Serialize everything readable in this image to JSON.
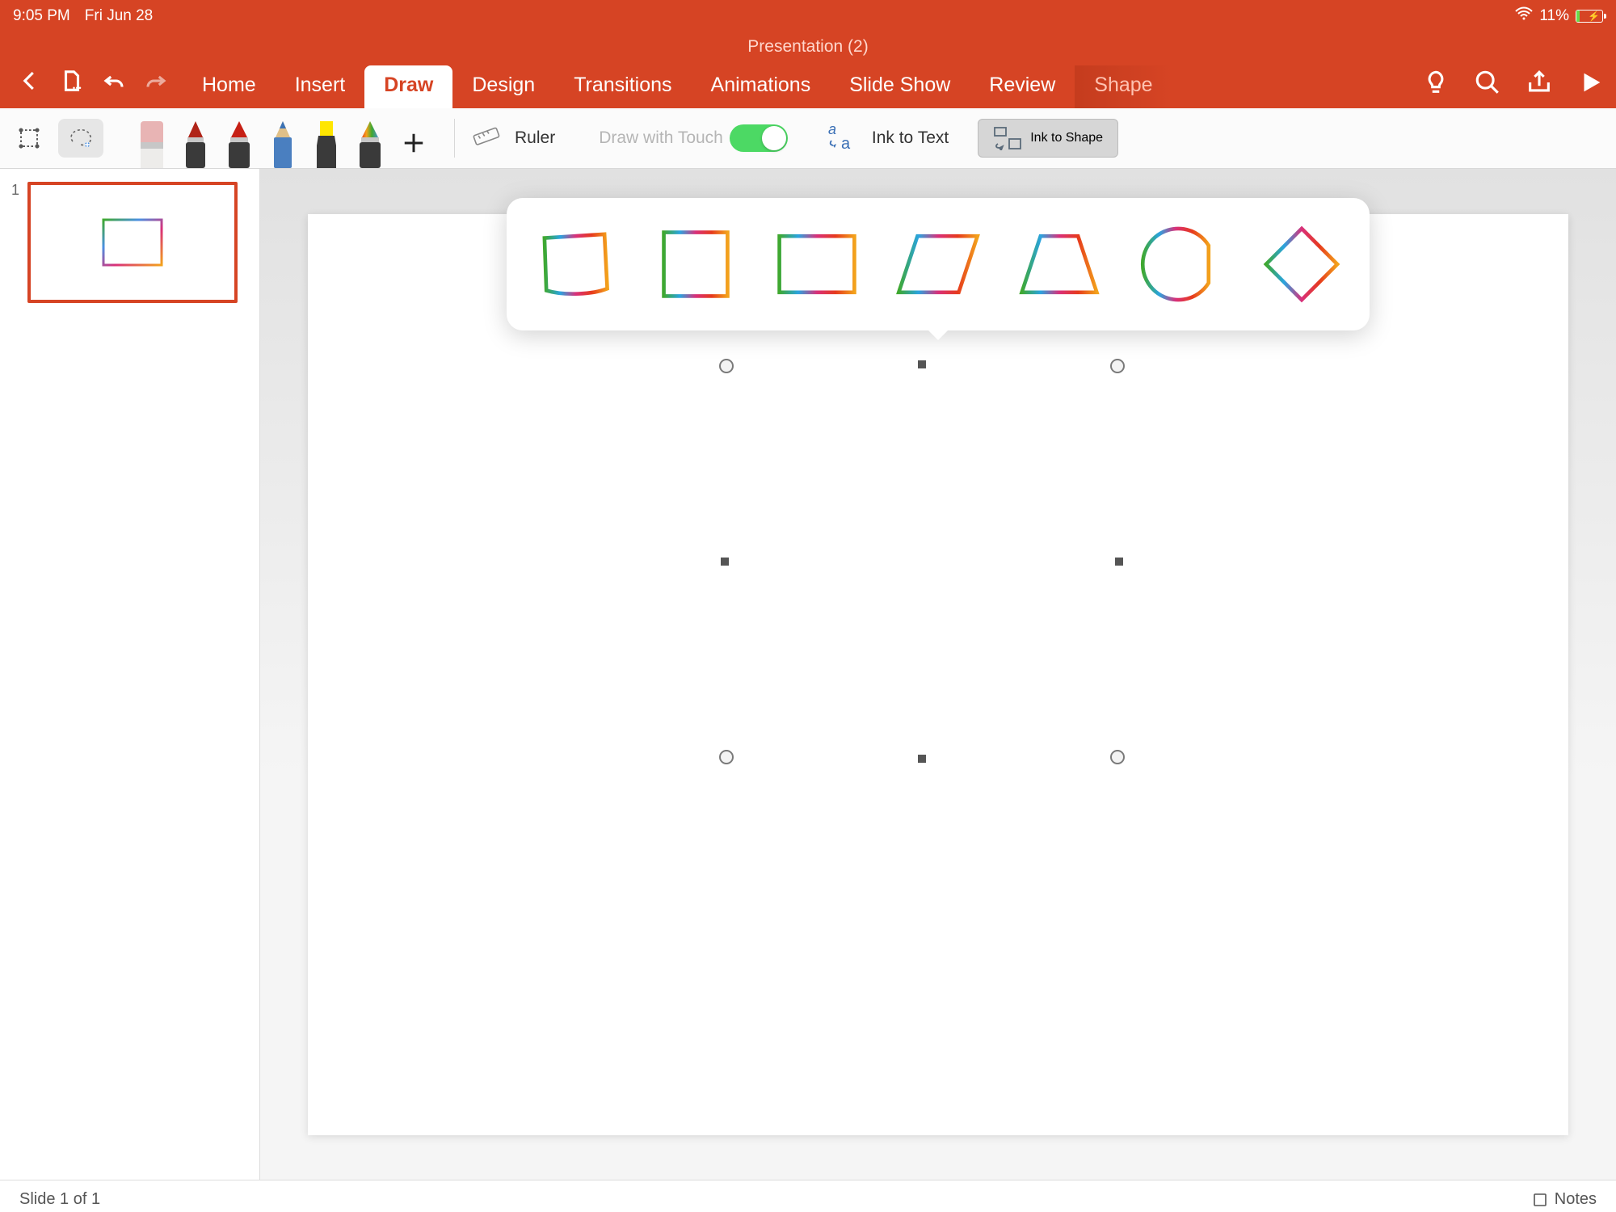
{
  "status": {
    "time": "9:05 PM",
    "date": "Fri Jun 28",
    "battery": "11%"
  },
  "title": "Presentation (2)",
  "tabs": [
    "Home",
    "Insert",
    "Draw",
    "Design",
    "Transitions",
    "Animations",
    "Slide Show",
    "Review",
    "Shape"
  ],
  "active_tab": "Draw",
  "toolbar": {
    "ruler": "Ruler",
    "draw_touch": "Draw with Touch",
    "ink_text": "Ink to Text",
    "ink_shape": "Ink to Shape"
  },
  "thumb_index": "1",
  "footer": {
    "slide": "Slide 1 of 1",
    "notes": "Notes"
  },
  "suggestions": [
    "freeform",
    "square",
    "rectangle",
    "parallelogram",
    "trapezoid",
    "partial-circle",
    "diamond"
  ]
}
